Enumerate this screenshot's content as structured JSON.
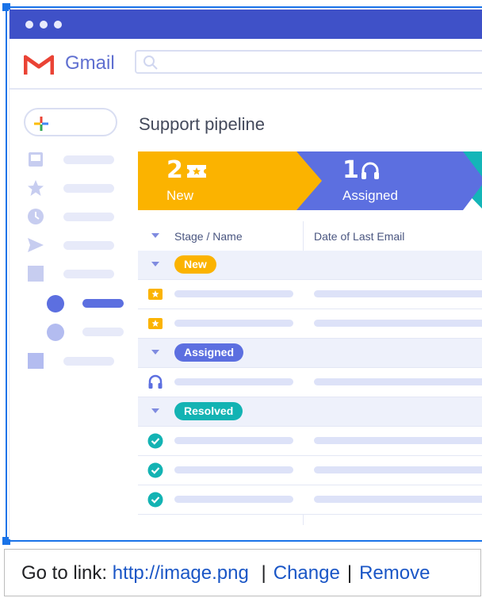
{
  "app": {
    "name": "Gmail"
  },
  "page": {
    "title": "Support pipeline"
  },
  "pipeline": {
    "stages": [
      {
        "count": "2",
        "label": "New",
        "color": "#fbb300",
        "icon": "ticket-icon"
      },
      {
        "count": "1",
        "label": "Assigned",
        "color": "#5c6fe0",
        "icon": "headset-icon"
      }
    ],
    "third_stage_color": "#14b5b8"
  },
  "table": {
    "columns": [
      "Stage / Name",
      "Date of Last Email"
    ],
    "groups": [
      {
        "label": "New",
        "color": "#fbb300",
        "row_icon": "ticket-icon",
        "rows": 2
      },
      {
        "label": "Assigned",
        "color": "#5c6fe0",
        "row_icon": "headset-icon",
        "rows": 1
      },
      {
        "label": "Resolved",
        "color": "#13b3b3",
        "row_icon": "check-circle-icon",
        "rows": 3
      }
    ]
  },
  "link_bar": {
    "prefix": "Go to link:",
    "url": "http://image.png",
    "separator": "|",
    "change": "Change",
    "remove": "Remove"
  },
  "colors": {
    "titlebar": "#3f51c8",
    "accent_blue": "#5c6fe0",
    "link": "#1a56c6",
    "selection": "#1a73e8"
  }
}
